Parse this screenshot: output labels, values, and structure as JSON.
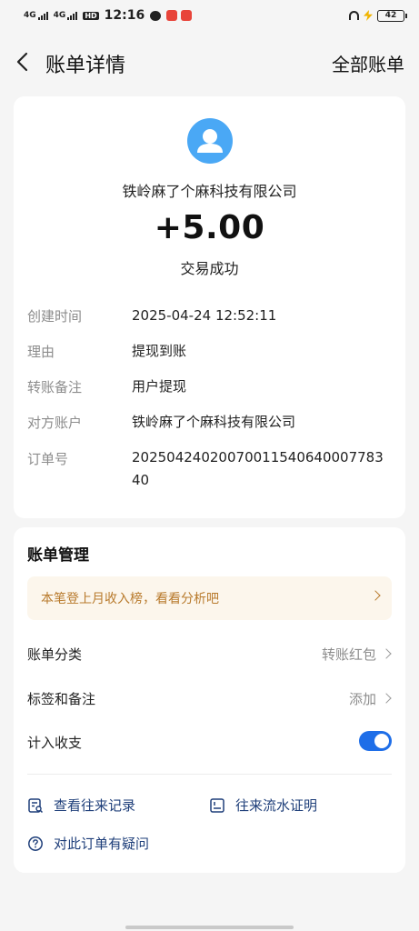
{
  "status_bar": {
    "net1": "4G",
    "net2": "4G",
    "hd": "HD",
    "time": "12:16",
    "battery": "42"
  },
  "header": {
    "title": "账单详情",
    "right_link": "全部账单"
  },
  "transaction": {
    "payee": "铁岭麻了个麻科技有限公司",
    "amount": "+5.00",
    "status": "交易成功"
  },
  "details": [
    {
      "label": "创建时间",
      "value": "2025-04-24 12:52:11"
    },
    {
      "label": "理由",
      "value": "提现到账"
    },
    {
      "label": "转账备注",
      "value": "用户提现"
    },
    {
      "label": "对方账户",
      "value": "铁岭麻了个麻科技有限公司"
    },
    {
      "label": "订单号",
      "value": "2025042402007001154064000778340"
    }
  ],
  "management": {
    "title": "账单管理",
    "promo": "本笔登上月收入榜，看看分析吧",
    "category_label": "账单分类",
    "category_value": "转账红包",
    "tags_label": "标签和备注",
    "tags_value": "添加",
    "count_label": "计入收支",
    "count_enabled": true,
    "links": {
      "history": "查看往来记录",
      "proof": "往来流水证明",
      "question": "对此订单有疑问"
    }
  },
  "colors": {
    "accent": "#1e6ee8",
    "avatar": "#4aa8f5",
    "promo_bg": "#fcf6ec",
    "promo_text": "#b87a2c",
    "link": "#1f3f7a"
  }
}
